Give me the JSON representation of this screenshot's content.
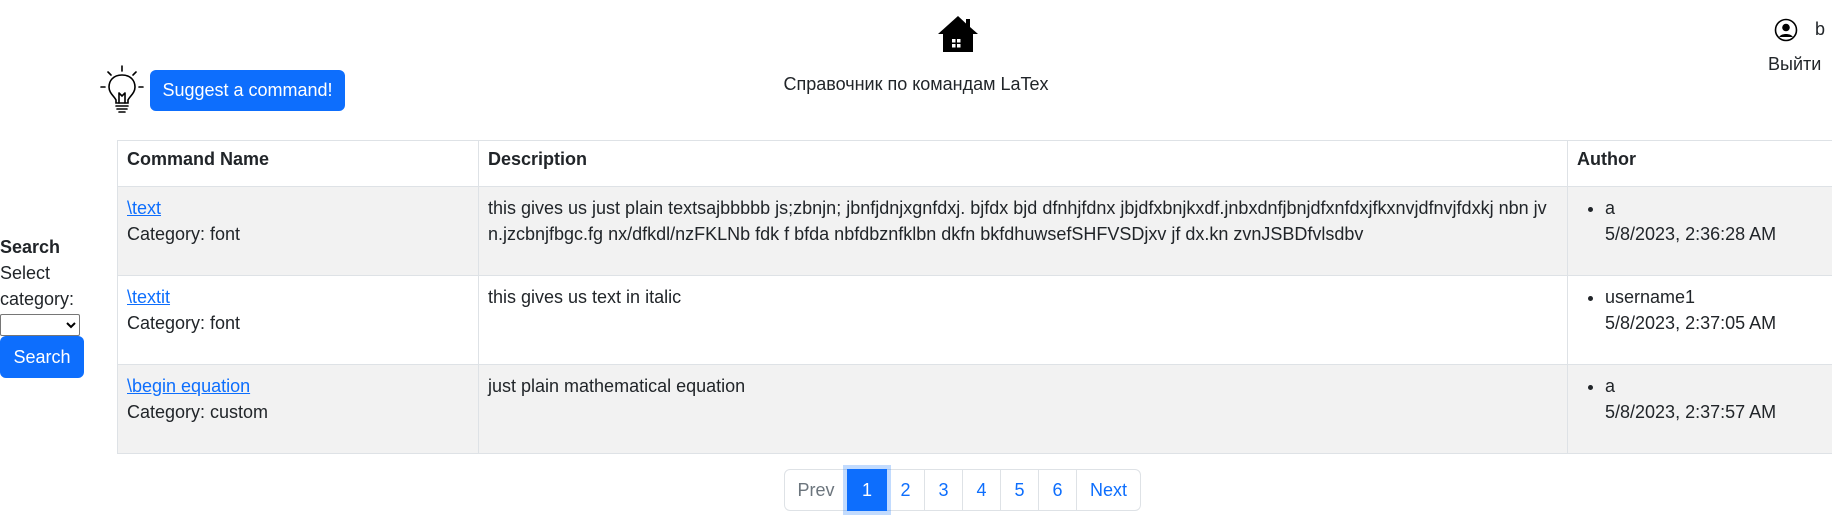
{
  "header": {
    "site_title": "Справочник по командам LaTex",
    "suggest_label": "Suggest a command!",
    "username": "b",
    "logout_label": "Выйти"
  },
  "search": {
    "title": "Search",
    "select_label": "Select category:",
    "category_value": "",
    "button_label": "Search"
  },
  "table": {
    "headers": [
      "Command Name",
      "Description",
      "Author"
    ],
    "rows": [
      {
        "command": "\\text",
        "category": "Category: font",
        "description": "this gives us just plain textsajbbbbb js;zbnjn; jbnfjdnjxgnfdxj. bjfdx bjd dfnhjfdnx jbjdfxbnjkxdf.jnbxdnfjbnjdfxnfdxjfkxnvjdfnvjfdxkj nbn jv n.jzcbnjfbgc.fg nx/dfkdl/nzFKLNb fdk f bfda nbfdbznfklbn dkfn bkfdhuwsefSHFVSDjxv jf dx.kn zvnJSBDfvlsdbv",
        "author": "a",
        "date": "5/8/2023, 2:36:28 AM"
      },
      {
        "command": "\\textit",
        "category": "Category: font",
        "description": "this gives us text in italic",
        "author": "username1",
        "date": "5/8/2023, 2:37:05 AM"
      },
      {
        "command": "\\begin equation",
        "category": "Category: custom",
        "description": "just plain mathematical equation",
        "author": "a",
        "date": "5/8/2023, 2:37:57 AM"
      }
    ]
  },
  "pagination": {
    "prev": "Prev",
    "pages": [
      "1",
      "2",
      "3",
      "4",
      "5",
      "6"
    ],
    "active_page": "1",
    "next": "Next"
  },
  "icons": {
    "home": "home-icon",
    "lightbulb": "lightbulb-icon",
    "user": "user-circle-icon"
  },
  "colors": {
    "primary": "#0d6efd",
    "stripe": "#f2f2f2",
    "border": "#dee2e6"
  }
}
